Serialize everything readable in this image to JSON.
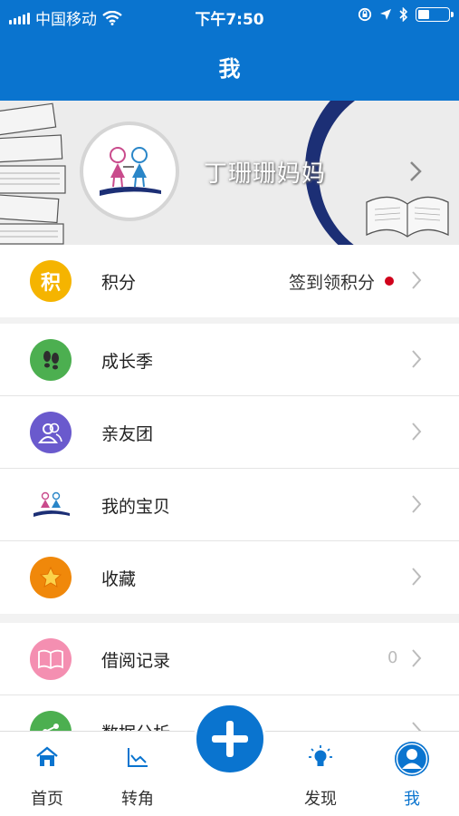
{
  "status_bar": {
    "carrier": "中国移动",
    "time": "下午7:50"
  },
  "nav": {
    "title": "我"
  },
  "profile": {
    "name": "丁珊珊妈妈"
  },
  "points": {
    "icon_text": "积",
    "label": "积分",
    "action": "签到领积分"
  },
  "menu": {
    "growth_season": "成长季",
    "friends_group": "亲友团",
    "my_baby": "我的宝贝",
    "favorites": "收藏",
    "borrow_records": "借阅记录",
    "borrow_count": "0",
    "data_analysis": "数据分析"
  },
  "tabs": {
    "home": "首页",
    "corner": "转角",
    "discover": "发现",
    "me": "我"
  },
  "colors": {
    "brand_blue": "#0a74cf",
    "points_yellow": "#f5b400",
    "growth_green": "#4caf50",
    "friends_purple": "#6a5acd",
    "favorites_orange": "#f0880a",
    "borrow_pink": "#f48fb1",
    "alert_red": "#d0021b"
  },
  "icons": {
    "points": "points-coin-icon",
    "growth": "footprints-icon",
    "friends": "people-icon",
    "baby": "children-logo-icon",
    "favorites": "star-icon",
    "borrow": "open-book-icon",
    "data": "share-chart-icon"
  }
}
